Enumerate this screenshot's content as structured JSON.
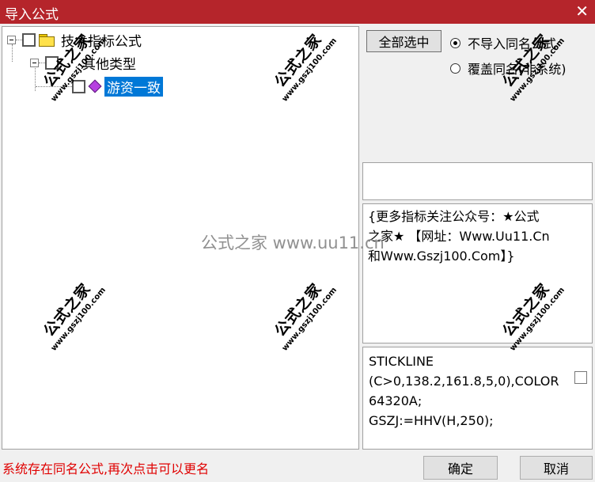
{
  "window": {
    "title": "导入公式",
    "close_glyph": "✕"
  },
  "tree": {
    "root": {
      "label": "技术指标公式",
      "icon": "folder-icon",
      "checked": false
    },
    "category": {
      "label": "其他类型",
      "checked": false
    },
    "item": {
      "label": "游资一致",
      "icon": "gem-icon",
      "selected": true,
      "checked": false
    }
  },
  "options": {
    "select_all_label": "全部选中",
    "radio_skip_label": "不导入同名公式",
    "radio_overwrite_label": "覆盖同名(非系统)",
    "selected": "skip"
  },
  "description": {
    "text": "{更多指标关注公众号：★公式\n之家★ 【网址：Www.Uu11.Cn\n和Www.Gszj100.Com】}"
  },
  "code": {
    "text": "STICKLINE\n(C>0,138.2,161.8,5,0),COLOR\n64320A;\nGSZJ:=HHV(H,250);"
  },
  "status": {
    "message": "系统存在同名公式,再次点击可以更名",
    "color": "#e00000"
  },
  "footer": {
    "ok_label": "确定",
    "cancel_label": "取消"
  },
  "watermark": {
    "center_text": "公式之家 www.uu11.cn",
    "stamp_text": "公式之家",
    "stamp_url": "www.gszj100.com"
  },
  "colors": {
    "titlebar": "#b5252b",
    "selection": "#0078d7",
    "status_text": "#e00000"
  }
}
